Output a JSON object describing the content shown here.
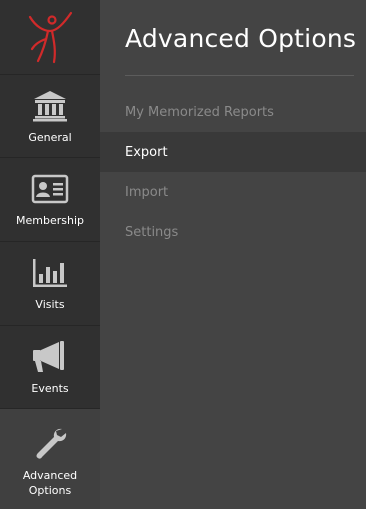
{
  "sidebar": {
    "logo_icon": "figure-logo-icon",
    "items": [
      {
        "label": "General",
        "icon": "bank-building-icon"
      },
      {
        "label": "Membership",
        "icon": "id-card-icon"
      },
      {
        "label": "Visits",
        "icon": "bar-chart-icon"
      },
      {
        "label": "Events",
        "icon": "megaphone-icon"
      },
      {
        "label": "Advanced Options",
        "icon": "wrench-icon",
        "active": true
      }
    ]
  },
  "main": {
    "title": "Advanced Options",
    "menu": [
      {
        "label": "My Memorized Reports"
      },
      {
        "label": "Export",
        "selected": true
      },
      {
        "label": "Import"
      },
      {
        "label": "Settings"
      }
    ]
  },
  "colors": {
    "sidebar_bg": "#303030",
    "main_bg": "#444444",
    "selected_bg": "#393939",
    "logo_red": "#d12a2a",
    "icon_gray": "#c8c8c8"
  }
}
